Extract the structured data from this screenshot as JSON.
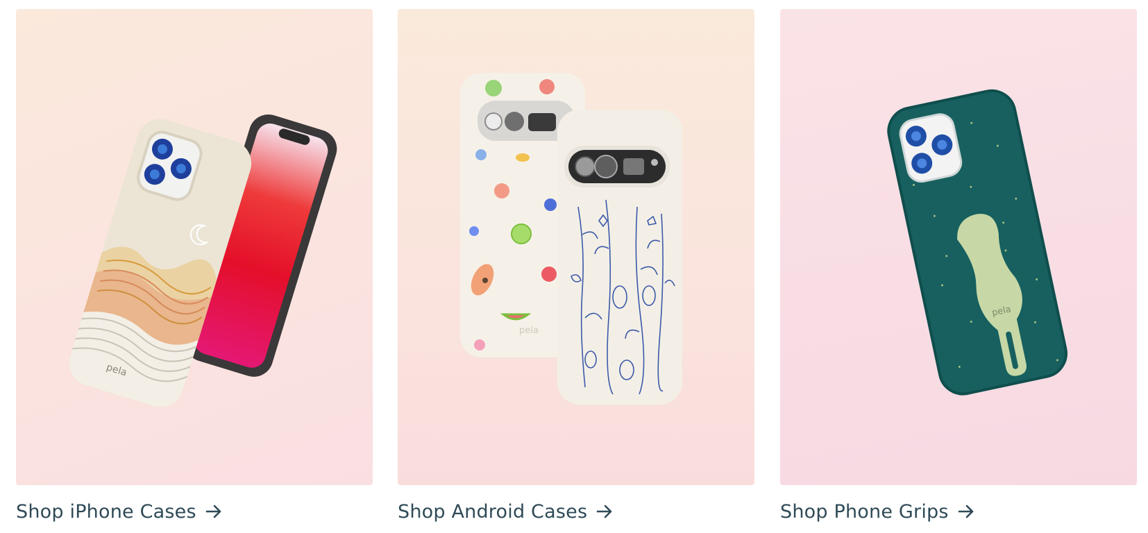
{
  "cards": [
    {
      "label": "Shop iPhone Cases",
      "icon": "arrow-right-icon"
    },
    {
      "label": "Shop Android Cases",
      "icon": "arrow-right-icon"
    },
    {
      "label": "Shop Phone Grips",
      "icon": "arrow-right-icon"
    }
  ],
  "brand_mark": "pela",
  "colors": {
    "text": "#2f4a57",
    "grip_case": "#17605f",
    "grip": "#c7d8a6",
    "floral_ink": "#3b59a8",
    "case_cream": "#f4eee2"
  }
}
